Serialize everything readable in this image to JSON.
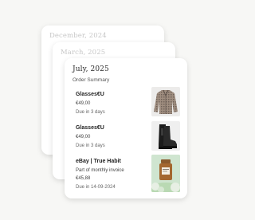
{
  "cards": {
    "back": {
      "month": "December, 2024"
    },
    "middle": {
      "month": "March, 2025"
    },
    "front": {
      "month": "July, 2025",
      "section_title": "Order Summary",
      "orders": [
        {
          "merchant": "Glasses€U",
          "amount": "€49,00",
          "due": "Due in 3 days",
          "image": "checked-jacket"
        },
        {
          "merchant": "Glasses€U",
          "amount": "€49,00",
          "due": "Due in 3 days",
          "image": "black-boots"
        },
        {
          "merchant": "eBay | True Habit",
          "note": "Part of monthly invoice",
          "amount": "€45,88",
          "due": "Due in 14-09-2024",
          "image": "candle-jar"
        }
      ]
    }
  }
}
